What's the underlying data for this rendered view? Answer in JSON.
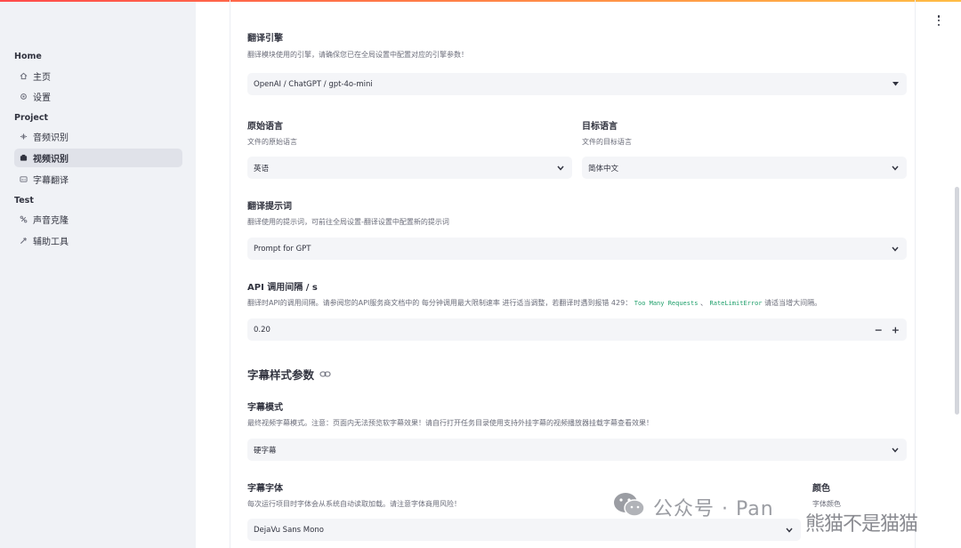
{
  "sidebar": {
    "sections": [
      {
        "title": "Home",
        "items": [
          {
            "label": "主页",
            "icon": "home-icon"
          },
          {
            "label": "设置",
            "icon": "gear-icon"
          }
        ]
      },
      {
        "title": "Project",
        "items": [
          {
            "label": "音频识别",
            "icon": "audio-wave-icon"
          },
          {
            "label": "视频识别",
            "icon": "video-camera-icon",
            "active": true
          },
          {
            "label": "字幕翻译",
            "icon": "subtitles-icon"
          }
        ]
      },
      {
        "title": "Test",
        "items": [
          {
            "label": "声音克隆",
            "icon": "voice-clone-icon"
          },
          {
            "label": "辅助工具",
            "icon": "tools-icon"
          }
        ]
      }
    ]
  },
  "engine": {
    "label": "翻译引擎",
    "help": "翻译模块使用的引擎，请确保您已在全局设置中配置对应的引擎参数！",
    "value": "OpenAI / ChatGPT / gpt-4o-mini"
  },
  "source_lang": {
    "label": "原始语言",
    "help": "文件的原始语言",
    "value": "英语"
  },
  "target_lang": {
    "label": "目标语言",
    "help": "文件的目标语言",
    "value": "简体中文"
  },
  "prompt": {
    "label": "翻译提示词",
    "help": "翻译使用的提示词，可前往全局设置-翻译设置中配置新的提示词",
    "value": "Prompt for GPT"
  },
  "api_interval": {
    "label": "API 调用间隔 / s",
    "help_prefix": "翻译时API的调用间隔。请参阅您的API服务商文档中的 每分钟调用最大限制速率 进行适当调整，若翻译时遇到报错 429：",
    "code1": "Too Many Requests",
    "sep": "、",
    "code2": "RateLimitError",
    "help_suffix": "请适当增大间隔。",
    "value": "0.20",
    "minus": "−",
    "plus": "+"
  },
  "subtitle_section": {
    "title": "字幕样式参数"
  },
  "subtitle_mode": {
    "label": "字幕模式",
    "help": "最终视频字幕模式。注意：页面内无法预览软字幕效果！请自行打开任务目录使用支持外挂字幕的视频播放器挂载字幕查看效果！",
    "value": "硬字幕"
  },
  "subtitle_font": {
    "label": "字幕字体",
    "help": "每次运行项目时字体会从系统自动读取加载。请注意字体商用风险！",
    "value": "DejaVu Sans Mono"
  },
  "color": {
    "label": "颜色",
    "help": "字体颜色"
  },
  "watermark": {
    "text": "公众号 · Pan",
    "tail": "熊猫不是猫猫"
  },
  "colors": {
    "accent": "#ff4b4b",
    "field_bg": "#f4f5f8",
    "sidebar_bg": "#f0f2f6"
  }
}
